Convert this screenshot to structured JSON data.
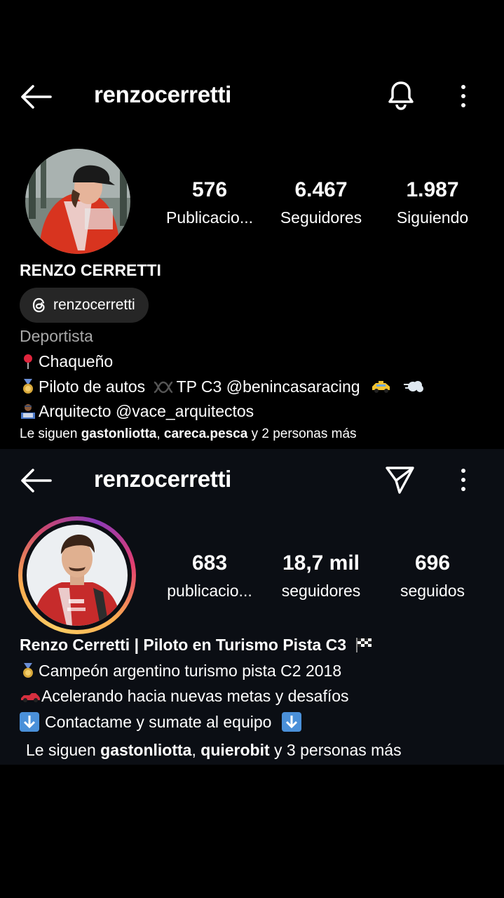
{
  "profile_a": {
    "username": "renzocerretti",
    "stats": [
      {
        "value": "576",
        "label": "Publicacio..."
      },
      {
        "value": "6.467",
        "label": "Seguidores"
      },
      {
        "value": "1.987",
        "label": "Siguiendo"
      }
    ],
    "display_name": "RENZO CERRETTI",
    "threads_handle": "renzocerretti",
    "category": "Deportista",
    "bio": {
      "line1": "Chaqueño",
      "line2_a": "Piloto de autos",
      "line2_b": "TP C3 @benincasaracing",
      "line3": "Arquitecto @vace_arquitectos"
    },
    "followed_by": {
      "prefix": "Le siguen ",
      "user1": "gastonliotta",
      "sep": ", ",
      "user2": "careca.pesca",
      "suffix": " y 2 personas más"
    }
  },
  "profile_b": {
    "username": "renzocerretti",
    "stats": [
      {
        "value": "683",
        "label": "publicacio..."
      },
      {
        "value": "18,7 mil",
        "label": "seguidores"
      },
      {
        "value": "696",
        "label": "seguidos"
      }
    ],
    "display_name": "Renzo Cerretti | Piloto en Turismo Pista C3",
    "bio": {
      "line1": "Campeón argentino turismo pista C2 2018",
      "line2": "Acelerando hacia nuevas metas y desafíos",
      "line3": "Contactame y sumate al equipo"
    },
    "followed_by": {
      "prefix": "Le siguen ",
      "user1": "gastonliotta",
      "sep": ", ",
      "user2": "quierobit",
      "suffix": " y 3 personas más"
    }
  }
}
